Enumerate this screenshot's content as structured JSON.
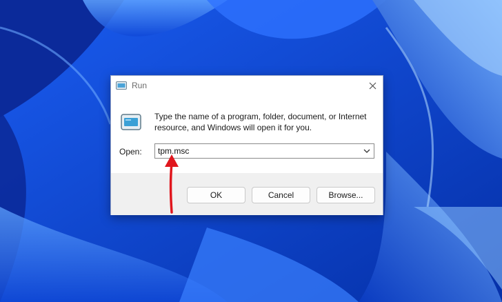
{
  "dialog": {
    "title": "Run",
    "description": "Type the name of a program, folder, document, or Internet resource, and Windows will open it for you.",
    "open_label": "Open:",
    "open_value": "tpm.msc",
    "buttons": {
      "ok": "OK",
      "cancel": "Cancel",
      "browse": "Browse..."
    },
    "icons": [
      "run-app-icon",
      "close-icon",
      "chevron-down-icon"
    ]
  },
  "annotation": {
    "type": "arrow",
    "color": "#e0161d",
    "points_to": "open-combobox"
  },
  "colors": {
    "wallpaper": "#0a3fc9",
    "dialog_bg": "#ffffff",
    "button_bar_bg": "#f0f0f0"
  }
}
